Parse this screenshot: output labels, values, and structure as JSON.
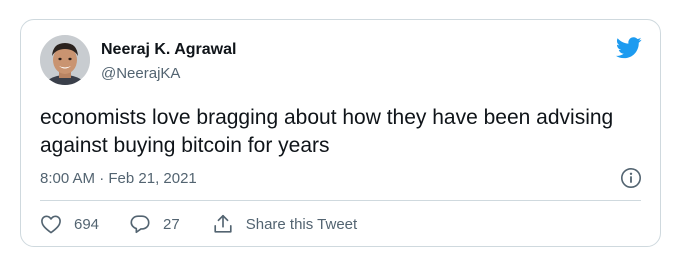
{
  "author": {
    "name": "Neeraj K. Agrawal",
    "handle": "@NeerajKA"
  },
  "tweet": {
    "text": "economists love bragging about how they have been advising against buying bitcoin for years",
    "timestamp": "8:00 AM · Feb 21, 2021"
  },
  "actions": {
    "likes": "694",
    "replies": "27",
    "share_label": "Share this Tweet"
  },
  "icons": {
    "logo": "twitter-bird-icon",
    "info": "info-icon",
    "like": "heart-icon",
    "reply": "reply-bubble-icon",
    "share": "share-icon"
  },
  "colors": {
    "twitter_blue": "#1d9bf0",
    "text_primary": "#0f1419",
    "text_secondary": "#536471",
    "border": "#cfd9de"
  }
}
